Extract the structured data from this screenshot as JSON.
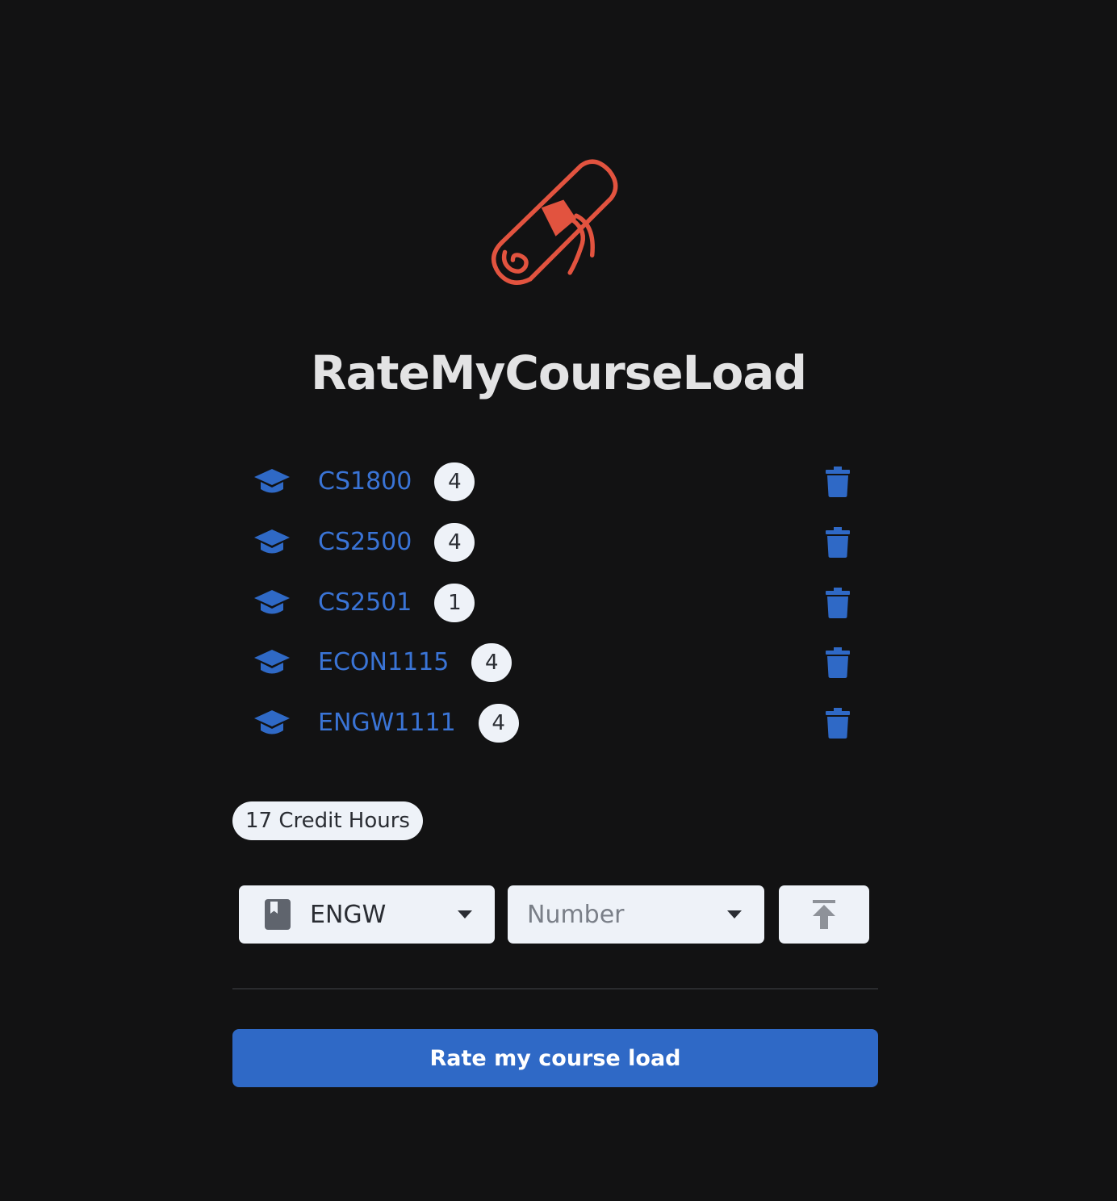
{
  "app": {
    "title": "RateMyCourseLoad",
    "logo_icon": "diploma-scroll-icon",
    "logo_color": "#e2533f"
  },
  "courses": [
    {
      "code": "CS1800",
      "credits": "4",
      "icon": "graduation-cap-icon"
    },
    {
      "code": "CS2500",
      "credits": "4",
      "icon": "graduation-cap-icon"
    },
    {
      "code": "CS2501",
      "credits": "1",
      "icon": "graduation-cap-icon"
    },
    {
      "code": "ECON1115",
      "credits": "4",
      "icon": "graduation-cap-icon"
    },
    {
      "code": "ENGW1111",
      "credits": "4",
      "icon": "graduation-cap-icon"
    }
  ],
  "summary": {
    "credit_hours": "17 Credit Hours"
  },
  "add_course": {
    "subject_value": "ENGW",
    "subject_icon": "book-icon",
    "number_placeholder": "Number",
    "add_icon": "upload-arrow-icon"
  },
  "actions": {
    "rate_label": "Rate my course load"
  },
  "colors": {
    "background": "#121213",
    "accent": "#3a74d6",
    "button": "#2f69c6",
    "badge_bg": "#eef2f8"
  }
}
